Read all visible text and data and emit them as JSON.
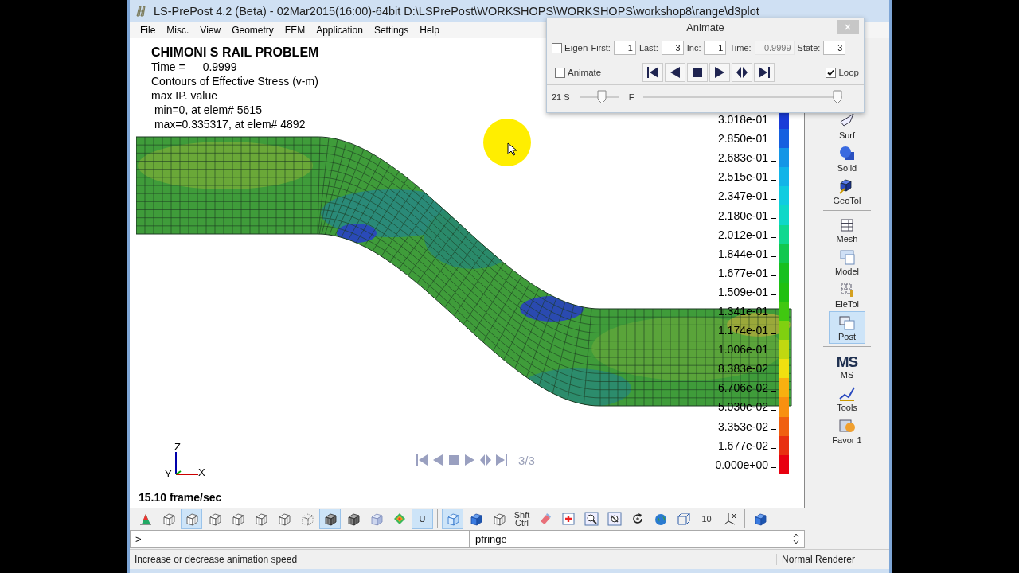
{
  "window": {
    "title": "LS-PrePost 4.2 (Beta) - 02Mar2015(16:00)-64bit D:\\LSPrePost\\WORKSHOPS\\WORKSHOPS\\workshop8\\range\\d3plot"
  },
  "menu": [
    "File",
    "Misc.",
    "View",
    "Geometry",
    "FEM",
    "Application",
    "Settings",
    "Help"
  ],
  "viewport": {
    "title": "CHIMONI S RAIL PROBLEM",
    "time": {
      "label": "Time =",
      "value": "0.9999"
    },
    "lines": [
      "Contours of Effective Stress (v-m)",
      "max IP. value",
      " min=0, at elem# 5615",
      " max=0.335317, at elem# 4892"
    ],
    "legend": [
      {
        "label": "3.018e-01",
        "color": "#1a3cd8"
      },
      {
        "label": "2.850e-01",
        "color": "#1560e0"
      },
      {
        "label": "2.683e-01",
        "color": "#1496e6"
      },
      {
        "label": "2.515e-01",
        "color": "#12b4e8"
      },
      {
        "label": "2.347e-01",
        "color": "#10cce0"
      },
      {
        "label": "2.180e-01",
        "color": "#0fd8c8"
      },
      {
        "label": "2.012e-01",
        "color": "#10d890"
      },
      {
        "label": "1.844e-01",
        "color": "#12c850"
      },
      {
        "label": "1.677e-01",
        "color": "#18c020"
      },
      {
        "label": "1.509e-01",
        "color": "#20c010"
      },
      {
        "label": "1.341e-01",
        "color": "#40c810"
      },
      {
        "label": "1.174e-01",
        "color": "#80d010"
      },
      {
        "label": "1.006e-01",
        "color": "#c0d810"
      },
      {
        "label": "8.383e-02",
        "color": "#f0e010"
      },
      {
        "label": "6.706e-02",
        "color": "#f8b010"
      },
      {
        "label": "5.030e-02",
        "color": "#f89010"
      },
      {
        "label": "3.353e-02",
        "color": "#f06010"
      },
      {
        "label": "1.677e-02",
        "color": "#e83010"
      },
      {
        "label": "0.000e+00",
        "color": "#e80010"
      }
    ],
    "axes": {
      "z": "Z",
      "y": "Y",
      "x": "X"
    },
    "frame_rate": "15.10 frame/sec",
    "counter": "3/3"
  },
  "sidebar": [
    {
      "label": "Surf",
      "kind": "icon",
      "selected": false
    },
    {
      "label": "Solid",
      "kind": "icon",
      "selected": false
    },
    {
      "label": "GeoTol",
      "kind": "icon",
      "selected": false
    },
    {
      "kind": "separator"
    },
    {
      "label": "Mesh",
      "kind": "icon",
      "selected": false
    },
    {
      "label": "Model",
      "kind": "icon",
      "selected": false
    },
    {
      "label": "EleTol",
      "kind": "icon",
      "selected": false
    },
    {
      "label": "Post",
      "kind": "icon",
      "selected": true
    },
    {
      "kind": "separator"
    },
    {
      "label": "MS",
      "kind": "text-icon",
      "icon_text": "MS",
      "selected": false
    },
    {
      "label": "Tools",
      "kind": "icon",
      "selected": false
    },
    {
      "label": "Favor 1",
      "kind": "icon",
      "selected": false
    }
  ],
  "animate_dialog": {
    "title": "Animate",
    "eigen": {
      "label": "Eigen",
      "checked": false
    },
    "fields": [
      {
        "label": "First:",
        "value": "1",
        "disabled": false
      },
      {
        "label": "Last:",
        "value": "3",
        "disabled": false
      },
      {
        "label": "Inc:",
        "value": "1",
        "disabled": false
      },
      {
        "label": "Time:",
        "value": "0.9999",
        "disabled": true
      },
      {
        "label": "State:",
        "value": "3",
        "disabled": false
      }
    ],
    "animate": {
      "label": "Animate",
      "checked": false
    },
    "loop": {
      "label": "Loop",
      "checked": true
    },
    "speed": {
      "label": "21 S",
      "level": 0.6
    },
    "frame": {
      "label": "F",
      "level": 1
    }
  },
  "toolbar": [
    {
      "kind": "icon",
      "selected": false
    },
    {
      "kind": "icon",
      "selected": false
    },
    {
      "kind": "icon",
      "selected": true
    },
    {
      "kind": "icon",
      "selected": false
    },
    {
      "kind": "icon",
      "selected": false
    },
    {
      "kind": "icon",
      "selected": false
    },
    {
      "kind": "icon",
      "selected": false
    },
    {
      "kind": "icon",
      "selected": false
    },
    {
      "kind": "icon",
      "selected": true
    },
    {
      "kind": "icon",
      "selected": false
    },
    {
      "kind": "icon",
      "selected": false
    },
    {
      "kind": "icon",
      "selected": false
    },
    {
      "kind": "text",
      "label": "U",
      "selected": true
    },
    {
      "kind": "separator"
    },
    {
      "kind": "icon",
      "selected": true
    },
    {
      "kind": "icon",
      "selected": false
    },
    {
      "kind": "icon",
      "selected": false
    },
    {
      "kind": "text",
      "label": "Shft Ctrl",
      "selected": false
    },
    {
      "kind": "icon",
      "selected": false
    },
    {
      "kind": "icon",
      "selected": false
    },
    {
      "kind": "icon",
      "selected": false
    },
    {
      "kind": "icon",
      "selected": false
    },
    {
      "kind": "icon",
      "selected": false
    },
    {
      "kind": "icon",
      "selected": false
    },
    {
      "kind": "icon",
      "selected": false
    },
    {
      "kind": "text",
      "label": "10",
      "selected": false
    },
    {
      "kind": "icon",
      "selected": false
    },
    {
      "kind": "separator"
    },
    {
      "kind": "icon",
      "selected": false
    }
  ],
  "command": {
    "prompt": ">",
    "value": "pfringe"
  },
  "status": {
    "message": "Increase or decrease animation speed",
    "renderer": "Normal Renderer"
  }
}
